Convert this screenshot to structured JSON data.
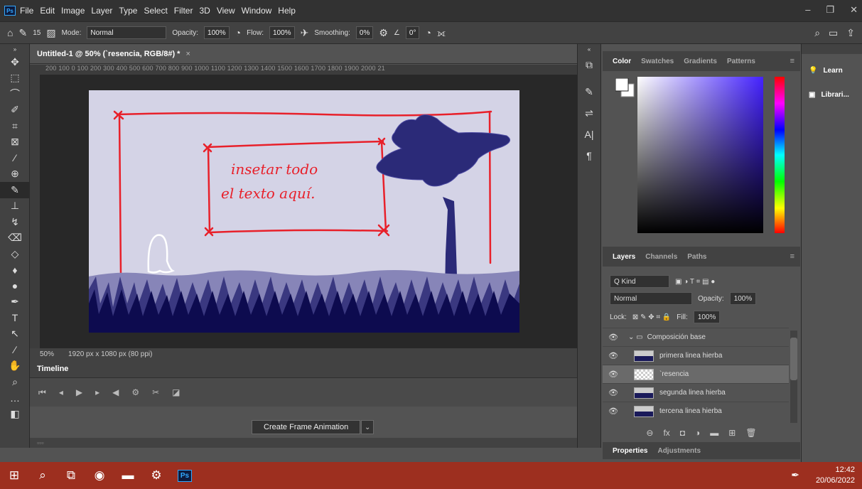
{
  "menubar": {
    "logo": "Ps",
    "items": [
      "File",
      "Edit",
      "Image",
      "Layer",
      "Type",
      "Select",
      "Filter",
      "3D",
      "View",
      "Window",
      "Help"
    ]
  },
  "options": {
    "brush_size": "15",
    "mode_label": "Mode:",
    "mode_value": "Normal",
    "opacity_label": "Opacity:",
    "opacity_value": "100%",
    "flow_label": "Flow:",
    "flow_value": "100%",
    "smoothing_label": "Smoothing:",
    "smoothing_value": "0%",
    "angle_value": "0°"
  },
  "document": {
    "tab_title": "Untitled-1 @ 50% (`resencia, RGB/8#) *",
    "ruler": "200   100   0     100   200   300   400   500   600   700   800   900   1000  1100  1200  1300  1400  1500  1600  1700  1800  1900  2000  21",
    "zoom": "50%",
    "doc_info": "1920 px x 1080 px (80 ppi)",
    "canvas_text_line1": "insetar todo",
    "canvas_text_line2": "el texto aquí."
  },
  "timeline": {
    "tab": "Timeline",
    "create_button": "Create Frame Animation"
  },
  "color_panel": {
    "tabs": [
      "Color",
      "Swatches",
      "Gradients",
      "Patterns"
    ]
  },
  "layers_panel": {
    "tabs": [
      "Layers",
      "Channels",
      "Paths"
    ],
    "kind_label": "Q Kind",
    "blend_mode": "Normal",
    "opacity_label": "Opacity:",
    "opacity_value": "100%",
    "lock_label": "Lock:",
    "fill_label": "Fill:",
    "fill_value": "100%",
    "group_name": "Composición base",
    "layers": [
      {
        "name": "primera linea hierba",
        "selected": false
      },
      {
        "name": "`resencia",
        "selected": true
      },
      {
        "name": "segunda linea hierba",
        "selected": false
      },
      {
        "name": "tercena linea hierba",
        "selected": false
      }
    ]
  },
  "properties_panel": {
    "tabs": [
      "Properties",
      "Adjustments"
    ]
  },
  "learn_panel": {
    "learn": "Learn",
    "libraries": "Librari..."
  },
  "taskbar": {
    "time": "12:42",
    "date": "20/06/2022",
    "ps_label": "Ps"
  },
  "colors": {
    "canvas_bg": "#d4d3e6",
    "frame_red": "#e8202a",
    "grass_dark": "#0d0b4f",
    "grass_mid": "#3a3880",
    "grass_light": "#8785b8",
    "tree": "#2b2a78",
    "taskbar": "#9d2f1f"
  }
}
